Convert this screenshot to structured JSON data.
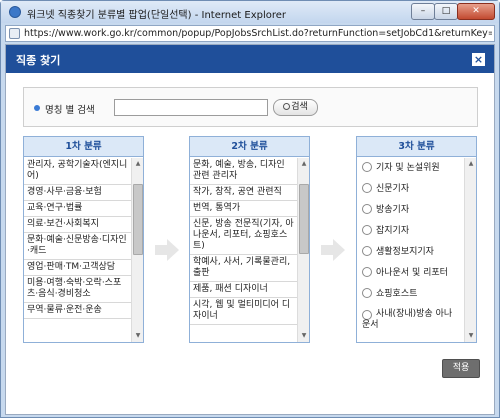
{
  "window": {
    "title": "워크넷 직종찾기 분류별 팝업(단일선택) - Internet Explorer",
    "address": "https://www.work.go.kr/common/popup/PopJobsSrchList.do?returnFunction=setJobCd1&returnKey=undefinec",
    "min_label": "–",
    "max_label": "□",
    "close_label": "✕"
  },
  "popup": {
    "title": "직종 찾기",
    "close_label": "×"
  },
  "search": {
    "label": "명칭 별 검색",
    "value": "",
    "placeholder": "",
    "button_label": "검색"
  },
  "columns": [
    {
      "header": "1차 분류",
      "items": [
        "관리자, 공학기술자(엔지니어)",
        "경영·사무·금융·보험",
        "교육·연구·법률",
        "의료·보건·사회복지",
        "문화·예술·신문방송·디자인·캐드",
        "영업·판매·TM·고객상담",
        "미용·여행·숙박·오락·스포츠·음식·경비청소",
        "무역·물류·운전·운송"
      ]
    },
    {
      "header": "2차 분류",
      "items": [
        "문화, 예술, 방송, 디자인 관련 관리자",
        "작가, 창작, 공연 관련직",
        "번역, 통역가",
        "신문, 방송 전문직(기자, 아나운서, 리포터, 쇼핑호스트)",
        "학예사, 사서, 기록물관리, 출판",
        "제품, 패션 디자이너",
        "시각, 웹 및 멀티미디어 디자이너"
      ]
    },
    {
      "header": "3차 분류",
      "items": [
        "기자 및 논설위원",
        "신문기자",
        "방송기자",
        "잡지기자",
        "생활정보지기자",
        "아나운서 및 리포터",
        "쇼핑호스트",
        "사내(장내)방송 아나운서"
      ]
    }
  ],
  "apply_label": "적용",
  "colors": {
    "header_bg": "#1f4f9a",
    "column_head_bg": "#dbe8f7",
    "apply_bg": "#6e6e6e"
  }
}
